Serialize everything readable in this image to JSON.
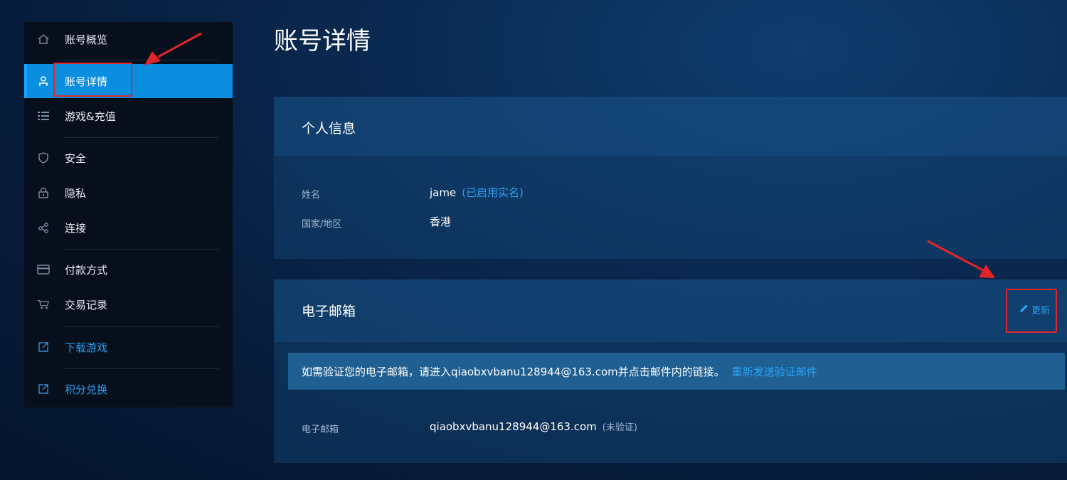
{
  "sidebar": {
    "items": [
      {
        "key": "overview",
        "label": "账号概览",
        "icon": "home-icon"
      },
      {
        "key": "details",
        "label": "账号详情",
        "icon": "user-icon",
        "active": true
      },
      {
        "key": "games",
        "label": "游戏&充值",
        "icon": "list-icon"
      },
      {
        "key": "security",
        "label": "安全",
        "icon": "shield-icon"
      },
      {
        "key": "privacy",
        "label": "隐私",
        "icon": "lock-icon"
      },
      {
        "key": "connections",
        "label": "连接",
        "icon": "share-icon"
      },
      {
        "key": "payment",
        "label": "付款方式",
        "icon": "card-icon"
      },
      {
        "key": "transactions",
        "label": "交易记录",
        "icon": "cart-icon"
      },
      {
        "key": "download",
        "label": "下载游戏",
        "icon": "external-link-icon"
      },
      {
        "key": "redeem",
        "label": "积分兑换",
        "icon": "external-link-icon"
      }
    ]
  },
  "main": {
    "title": "账号详情",
    "personal": {
      "title": "个人信息",
      "name_label": "姓名",
      "name_value": "jame",
      "name_status": "(已启用实名)",
      "region_label": "国家/地区",
      "region_value": "香港"
    },
    "email": {
      "title": "电子邮箱",
      "update_label": "更新",
      "notice_text": "如需验证您的电子邮箱，请进入qiaobxvbanu128944@163.com并点击邮件内的链接。",
      "notice_link": "重新发送验证邮件",
      "field_label": "电子邮箱",
      "field_value": "qiaobxvbanu128944@163.com",
      "field_status": "(未验证)"
    }
  },
  "colors": {
    "accent": "#2aa3f5",
    "active_nav": "#0b8de0",
    "annotation": "#e0262b"
  }
}
